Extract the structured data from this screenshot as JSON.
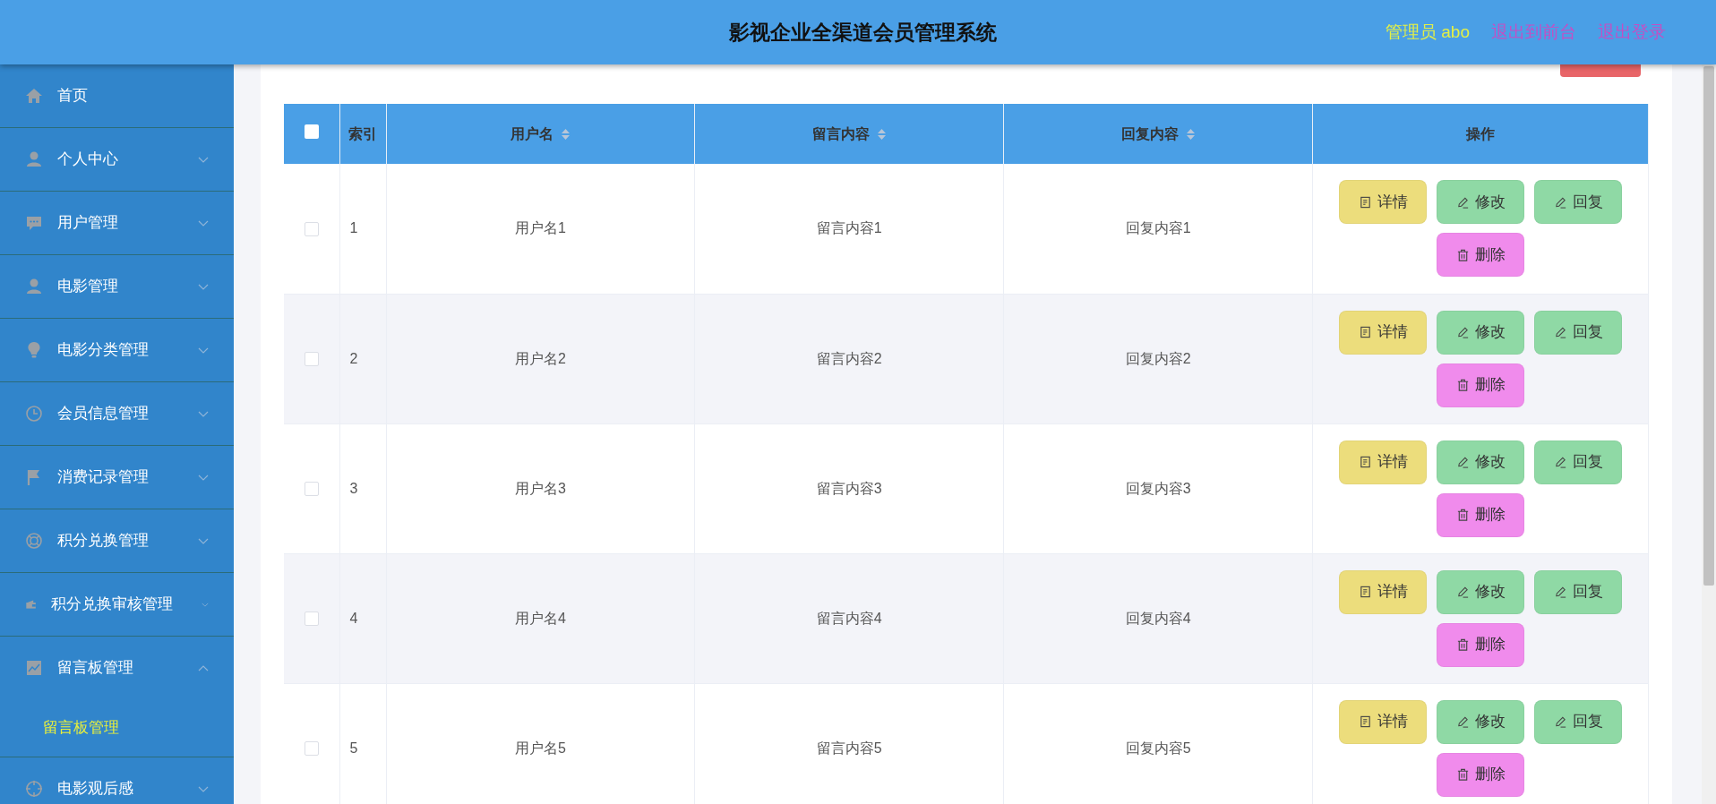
{
  "header": {
    "title": "影视企业全渠道会员管理系统",
    "user": "管理员 abo",
    "links": [
      "退出到前台",
      "退出登录"
    ]
  },
  "sidebar": {
    "items": [
      {
        "label": "首页",
        "kind": "link"
      },
      {
        "label": "个人中心",
        "kind": "menu",
        "expanded": false
      },
      {
        "label": "用户管理",
        "kind": "menu",
        "expanded": false
      },
      {
        "label": "电影管理",
        "kind": "menu",
        "expanded": false
      },
      {
        "label": "电影分类管理",
        "kind": "menu",
        "expanded": false
      },
      {
        "label": "会员信息管理",
        "kind": "menu",
        "expanded": false
      },
      {
        "label": "消费记录管理",
        "kind": "menu",
        "expanded": false
      },
      {
        "label": "积分兑换管理",
        "kind": "menu",
        "expanded": false
      },
      {
        "label": "积分兑换审核管理",
        "kind": "menu",
        "expanded": false
      },
      {
        "label": "留言板管理",
        "kind": "menu",
        "expanded": true,
        "children": [
          {
            "label": "留言板管理",
            "selected": true
          }
        ]
      },
      {
        "label": "电影观后感",
        "kind": "menu",
        "expanded": false
      }
    ]
  },
  "table": {
    "select_all": {
      "checked": false
    },
    "columns": [
      {
        "label": "索引",
        "sortable": false
      },
      {
        "label": "用户名",
        "sortable": true
      },
      {
        "label": "留言内容",
        "sortable": true
      },
      {
        "label": "回复内容",
        "sortable": true
      },
      {
        "label": "操作",
        "sortable": false
      }
    ],
    "rows": [
      {
        "selected": false,
        "cells": [
          "1",
          "用户名1",
          "留言内容1",
          "回复内容1"
        ],
        "actions": [
          {
            "label": "详情",
            "kind": "detail"
          },
          {
            "label": "修改",
            "kind": "edit"
          },
          {
            "label": "回复",
            "kind": "reply"
          },
          {
            "label": "删除",
            "kind": "delete"
          }
        ]
      },
      {
        "selected": false,
        "cells": [
          "2",
          "用户名2",
          "留言内容2",
          "回复内容2"
        ],
        "actions": [
          {
            "label": "详情",
            "kind": "detail"
          },
          {
            "label": "修改",
            "kind": "edit"
          },
          {
            "label": "回复",
            "kind": "reply"
          },
          {
            "label": "删除",
            "kind": "delete"
          }
        ]
      },
      {
        "selected": false,
        "cells": [
          "3",
          "用户名3",
          "留言内容3",
          "回复内容3"
        ],
        "actions": [
          {
            "label": "详情",
            "kind": "detail"
          },
          {
            "label": "修改",
            "kind": "edit"
          },
          {
            "label": "回复",
            "kind": "reply"
          },
          {
            "label": "删除",
            "kind": "delete"
          }
        ]
      },
      {
        "selected": false,
        "cells": [
          "4",
          "用户名4",
          "留言内容4",
          "回复内容4"
        ],
        "actions": [
          {
            "label": "详情",
            "kind": "detail"
          },
          {
            "label": "修改",
            "kind": "edit"
          },
          {
            "label": "回复",
            "kind": "reply"
          },
          {
            "label": "删除",
            "kind": "delete"
          }
        ]
      },
      {
        "selected": false,
        "cells": [
          "5",
          "用户名5",
          "留言内容5",
          "回复内容5"
        ],
        "actions": [
          {
            "label": "详情",
            "kind": "detail"
          },
          {
            "label": "修改",
            "kind": "edit"
          },
          {
            "label": "回复",
            "kind": "reply"
          },
          {
            "label": "删除",
            "kind": "delete"
          }
        ]
      }
    ]
  }
}
